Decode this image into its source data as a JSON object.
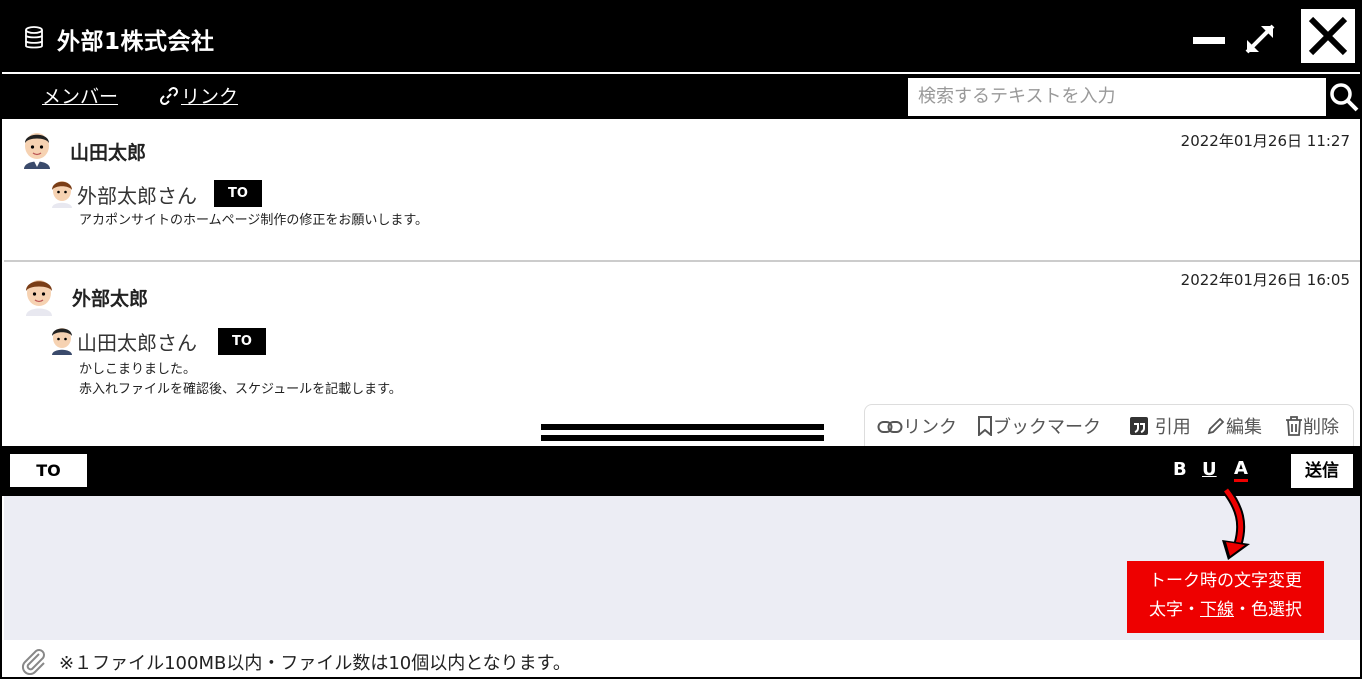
{
  "window": {
    "title": "外部1株式会社"
  },
  "nav": {
    "member_label": "メンバー",
    "link_label": "リンク",
    "search_placeholder": "検索するテキストを入力"
  },
  "messages": [
    {
      "sender": "山田太郎",
      "timestamp": "2022年01月26日 11:27",
      "recipient": "外部太郎さん",
      "to_badge": "TO",
      "body_lines": [
        "アカポンサイトのホームページ制作の修正をお願いします。"
      ]
    },
    {
      "sender": "外部太郎",
      "timestamp": "2022年01月26日 16:05",
      "recipient": "山田太郎さん",
      "to_badge": "TO",
      "body_lines": [
        "かしこまりました。",
        "赤入れファイルを確認後、スケジュールを記載します。"
      ]
    }
  ],
  "actions": {
    "link": "リンク",
    "bookmark": "ブックマーク",
    "quote": "引用",
    "edit": "編集",
    "delete": "削除"
  },
  "composer": {
    "to_button": "TO",
    "bold": "B",
    "underline": "U",
    "color": "A",
    "send": "送信"
  },
  "annotation": {
    "line1": "トーク時の文字変更",
    "line2_a": "太字・",
    "line2_b": "下線",
    "line2_c": "・色選択"
  },
  "footer": {
    "note": "※１ファイル100MB以内・ファイル数は10個以内となります。"
  },
  "colors": {
    "bar": "#000000",
    "composer_bg": "#ecedf4",
    "annotation": "#ee0000"
  }
}
